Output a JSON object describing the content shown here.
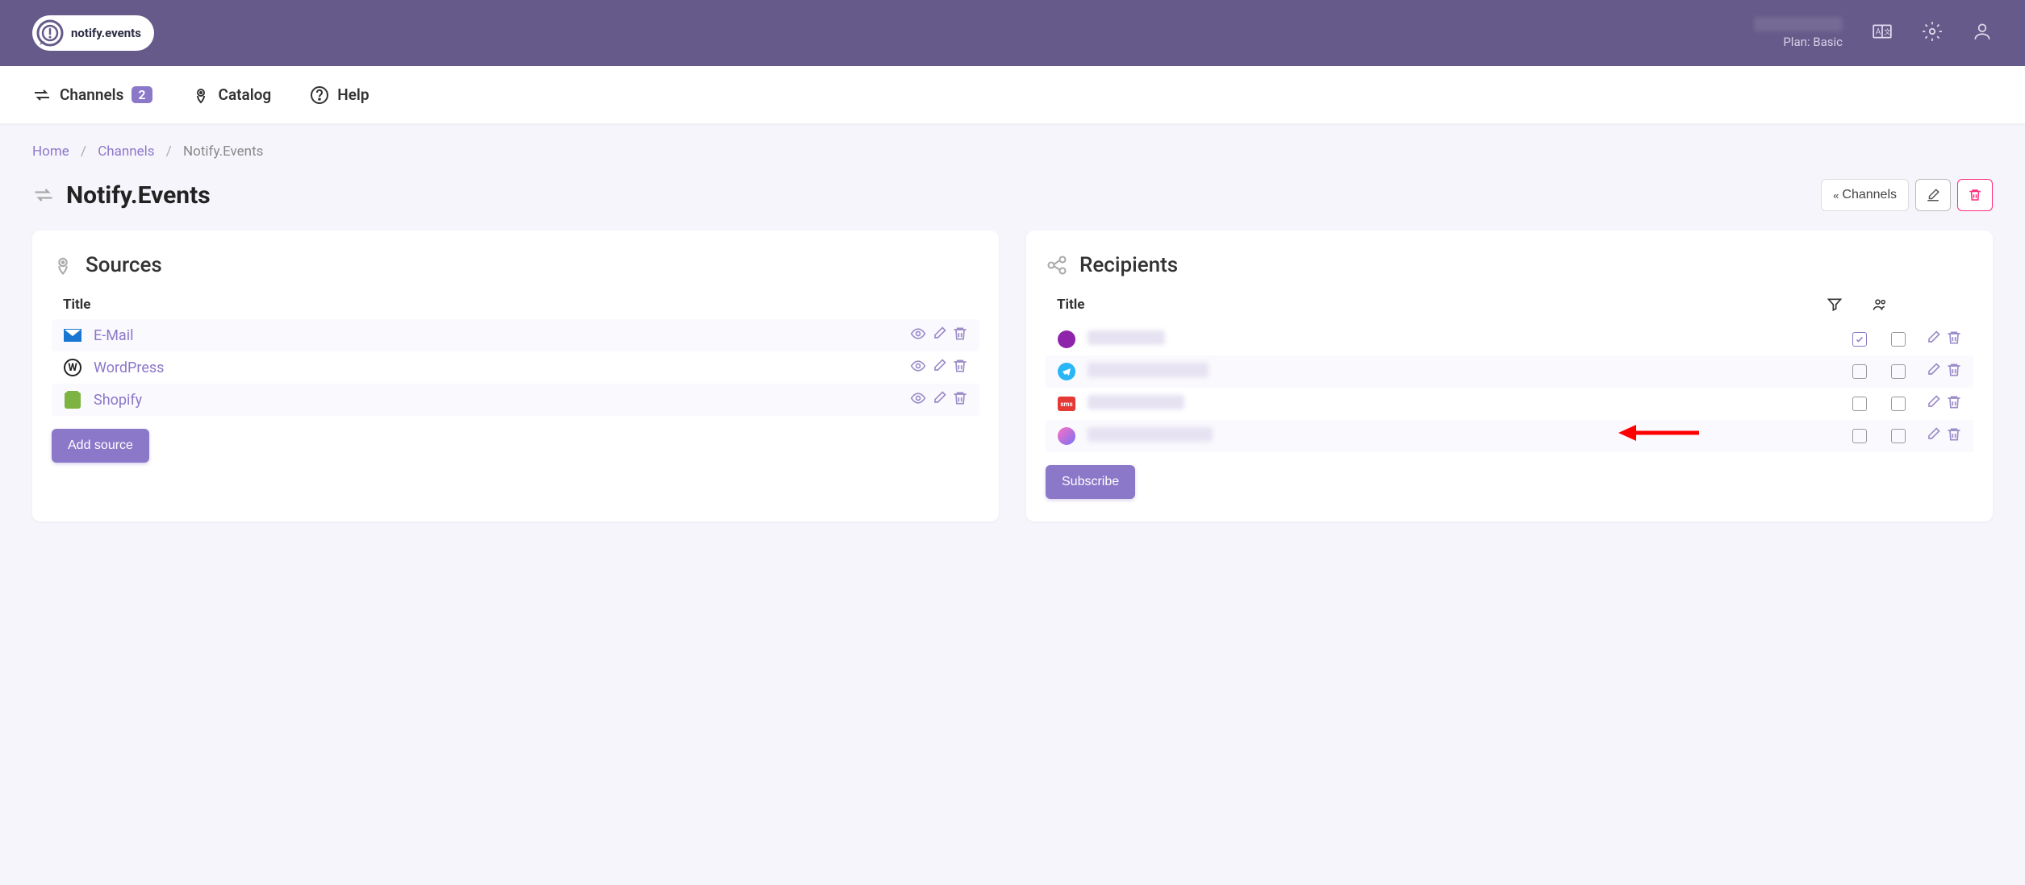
{
  "header": {
    "logo_text": "notify.events",
    "plan_label": "Plan: Basic"
  },
  "nav": {
    "channels": "Channels",
    "channels_count": "2",
    "catalog": "Catalog",
    "help": "Help"
  },
  "breadcrumb": {
    "home": "Home",
    "channels": "Channels",
    "current": "Notify.Events"
  },
  "page": {
    "title": "Notify.Events",
    "back_channels": "Channels"
  },
  "sources": {
    "title": "Sources",
    "col_title": "Title",
    "items": [
      {
        "label": "E-Mail"
      },
      {
        "label": "WordPress"
      },
      {
        "label": "Shopify"
      }
    ],
    "add_btn": "Add source"
  },
  "recipients": {
    "title": "Recipients",
    "col_title": "Title",
    "items": [
      {
        "icon": "viber",
        "filter_checked": true,
        "group_checked": false,
        "redact_w": 96
      },
      {
        "icon": "telegram",
        "filter_checked": false,
        "group_checked": false,
        "redact_w": 150
      },
      {
        "icon": "sms",
        "filter_checked": false,
        "group_checked": false,
        "redact_w": 120
      },
      {
        "icon": "messenger",
        "filter_checked": false,
        "group_checked": false,
        "redact_w": 155
      }
    ],
    "subscribe_btn": "Subscribe"
  }
}
